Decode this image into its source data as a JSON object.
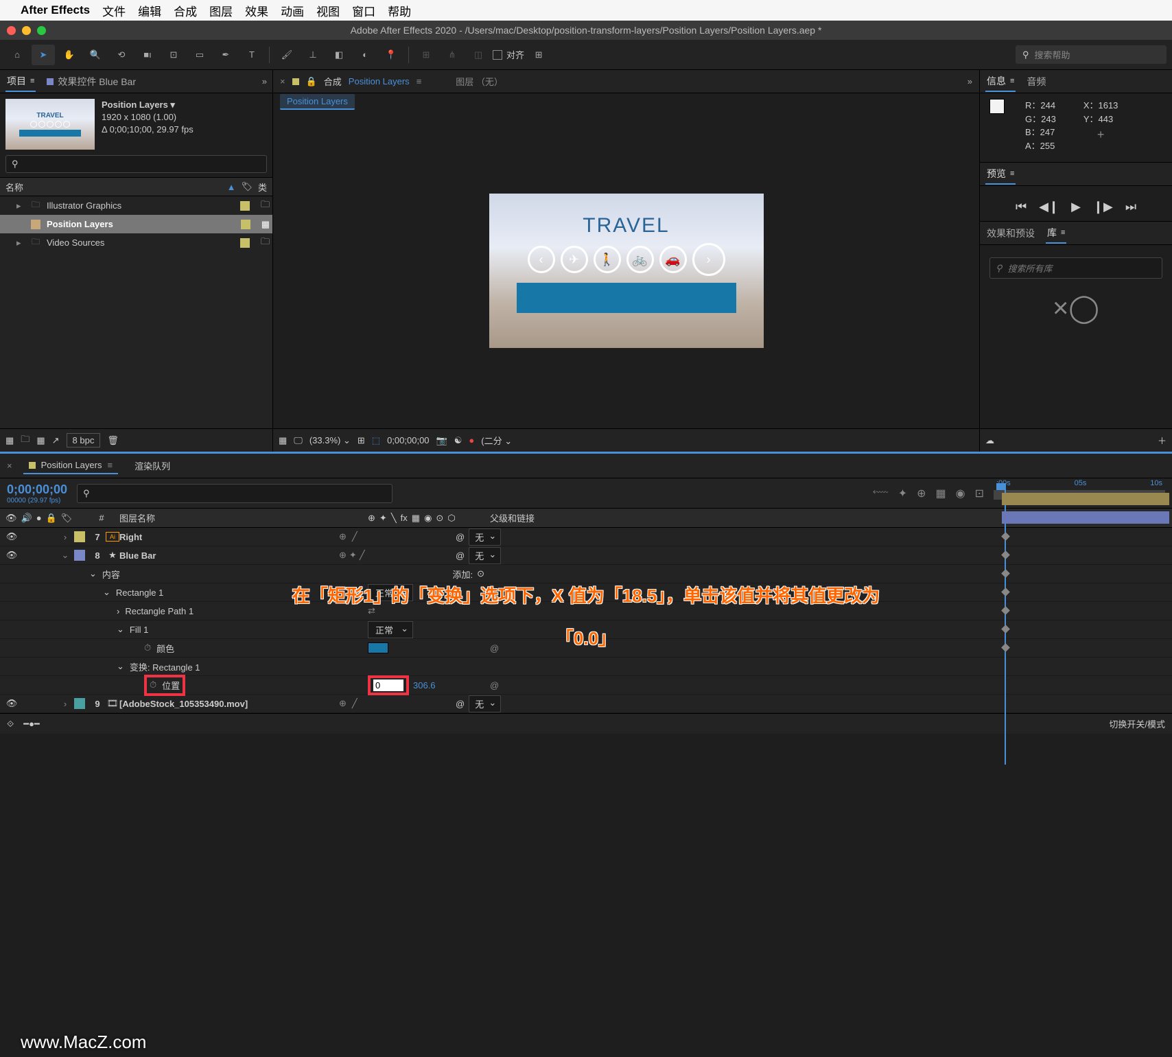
{
  "menubar": {
    "appname": "After Effects",
    "items": [
      "文件",
      "编辑",
      "合成",
      "图层",
      "效果",
      "动画",
      "视图",
      "窗口",
      "帮助"
    ]
  },
  "window_title": "Adobe After Effects 2020 - /Users/mac/Desktop/position-transform-layers/Position Layers/Position Layers.aep *",
  "toolbar": {
    "snap_label": "对齐",
    "search_placeholder": "搜索帮助"
  },
  "project": {
    "tab_project": "项目",
    "tab_effect_controls": "效果控件 Blue Bar",
    "comp_name": "Position Layers ▾",
    "comp_dims": "1920 x 1080 (1.00)",
    "comp_dur": "Δ 0;00;10;00, 29.97 fps",
    "col_name": "名称",
    "col_tag": "类",
    "items": [
      {
        "name": "Illustrator Graphics",
        "type": "folder",
        "tag": "#c8c068"
      },
      {
        "name": "Position Layers",
        "type": "comp",
        "tag": "#c8c068",
        "selected": true
      },
      {
        "name": "Video Sources",
        "type": "folder",
        "tag": "#c8c068"
      }
    ],
    "footer_bpc": "8 bpc"
  },
  "composition": {
    "tab_prefix": "合成",
    "tab_name": "Position Layers",
    "tab_layer": "图层 （无）",
    "breadcrumb": "Position Layers",
    "canvas_title": "TRAVEL",
    "footer": {
      "zoom": "(33.3%)",
      "time": "0;00;00;00",
      "quality": "(二分"
    }
  },
  "info": {
    "tab_info": "信息",
    "tab_audio": "音频",
    "R": "R：244",
    "G": "G：243",
    "B": "B：247",
    "A": "A：255",
    "X": "X：1613",
    "Y": "Y：443"
  },
  "preview": {
    "tab": "预览"
  },
  "library": {
    "tab_effects": "效果和预设",
    "tab_lib": "库",
    "search_placeholder": "搜索所有库"
  },
  "timeline": {
    "tab_name": "Position Layers",
    "tab_render": "渲染队列",
    "timecode": "0;00;00;00",
    "timecode_sub": "00000 (29.97 fps)",
    "ruler": [
      ":00s",
      "05s",
      "10s"
    ],
    "col_num": "#",
    "col_layername": "图层名称",
    "col_parent": "父级和链接",
    "layers": [
      {
        "num": "7",
        "name": "Right",
        "color": "#c8c068",
        "icon": "Ai",
        "parent": "无"
      },
      {
        "num": "8",
        "name": "Blue Bar",
        "color": "#7a88c8",
        "icon": "★",
        "parent": "无",
        "expanded": true
      }
    ],
    "props": {
      "content": "内容",
      "add": "添加:",
      "rect1": "Rectangle 1",
      "normal": "正常",
      "rectpath": "Rectangle Path 1",
      "fill": "Fill 1",
      "color": "颜色",
      "transform": "变换: Rectangle 1",
      "position": "位置",
      "pos_x": "0",
      "pos_y": "306.6"
    },
    "layer9": {
      "num": "9",
      "name": "[AdobeStock_105353490.mov]",
      "color": "#4aa0a0",
      "parent": "无"
    },
    "footer_toggle": "切换开关/模式"
  },
  "annotation": {
    "line1": "在「矩形1」的「变换」选项下，X 值为「18.5」，单击该值并将其值更改为",
    "line2": "「0.0」"
  },
  "watermark": "www.MacZ.com"
}
